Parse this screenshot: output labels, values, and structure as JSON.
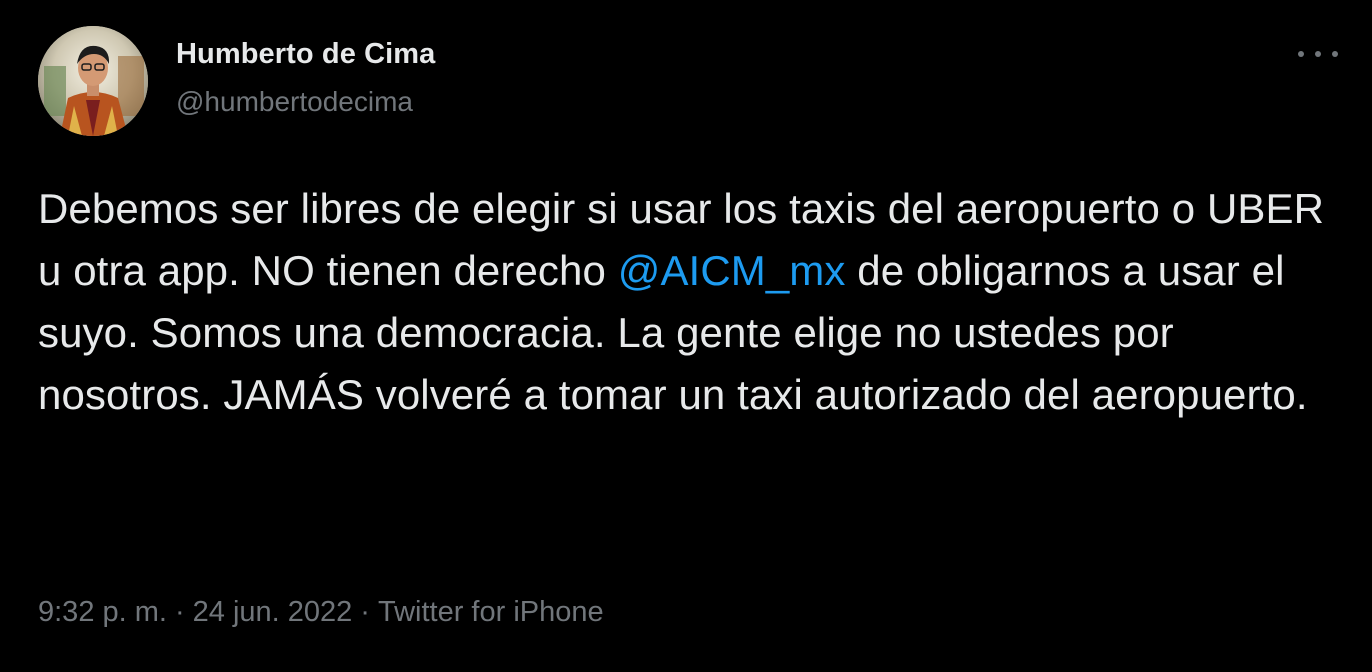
{
  "user": {
    "name": "Humberto de Cima",
    "handle": "@humbertodecima"
  },
  "tweet": {
    "text_before_mention": "Debemos ser libres de elegir si usar los taxis del aeropuerto o UBER u otra app. NO tienen derecho ",
    "mention": "@AICM_mx",
    "text_after_mention": " de obligarnos a usar el suyo. Somos una democracia. La gente elige no ustedes por nosotros. JAMÁS volveré a tomar un taxi autorizado del aeropuerto."
  },
  "meta": {
    "time": "9:32 p. m.",
    "separator": "·",
    "date": "24 jun. 2022",
    "source": "Twitter for iPhone"
  },
  "colors": {
    "background": "#000000",
    "text": "#e7e9ea",
    "secondary": "#71767b",
    "link": "#1d9bf0"
  },
  "icons": {
    "more": "more-horizontal-icon"
  }
}
